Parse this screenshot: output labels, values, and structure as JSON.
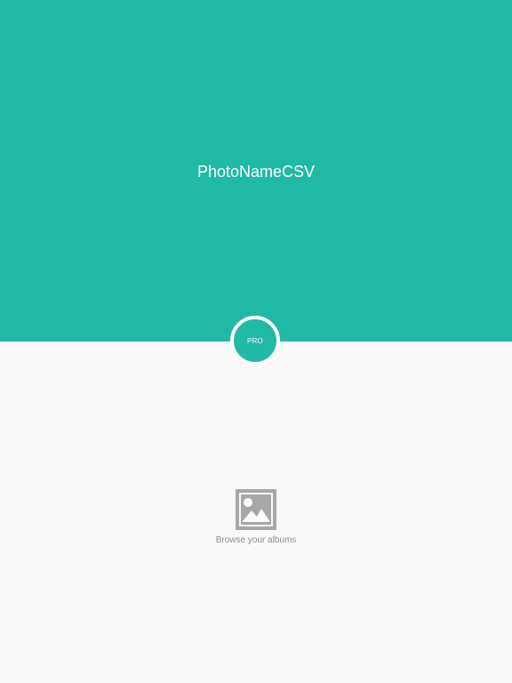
{
  "header": {
    "title": "PhotoNameCSV"
  },
  "pro_badge": {
    "label": "PRO"
  },
  "browse": {
    "label": "Browse your albums",
    "icon": "photo-icon"
  },
  "colors": {
    "accent": "#20b9a4",
    "background": "#fafafa",
    "icon_gray": "#a7a7a7",
    "label_gray": "#8a8a8a"
  }
}
